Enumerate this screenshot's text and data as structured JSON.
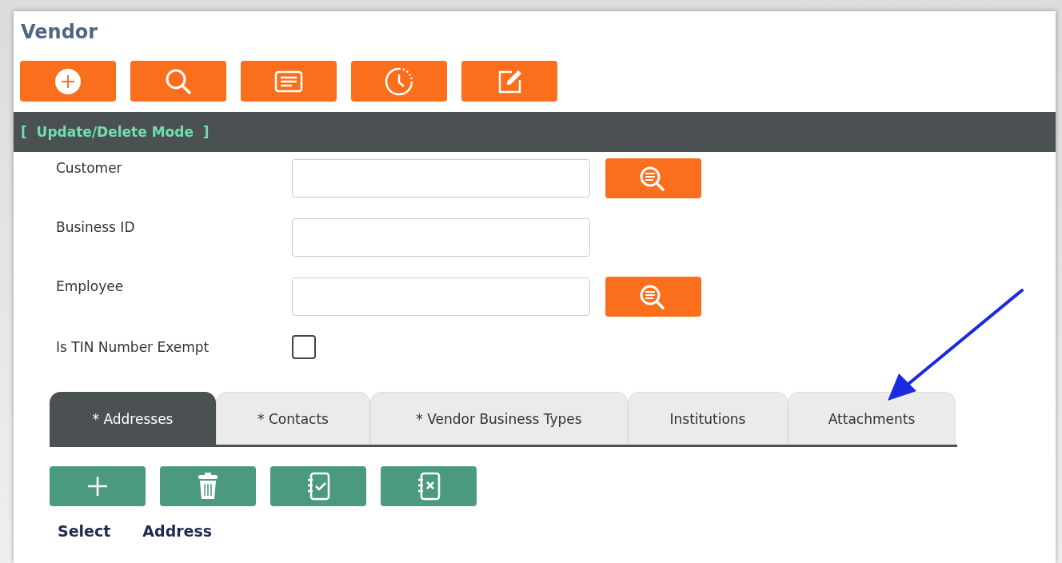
{
  "title": "Vendor",
  "mode": "[  Update/Delete Mode  ]",
  "fields": [
    {
      "label": "Customer",
      "kind": "lookup"
    },
    {
      "label": "Business ID",
      "kind": "text"
    },
    {
      "label": "Employee",
      "kind": "lookup"
    },
    {
      "label": "Is TIN Number Exempt",
      "kind": "checkbox",
      "checked": false
    }
  ],
  "tabs": [
    {
      "label": "* Addresses",
      "selected": true
    },
    {
      "label": "* Contacts",
      "selected": false
    },
    {
      "label": "* Vendor Business Types",
      "selected": false
    },
    {
      "label": "Institutions",
      "selected": false
    },
    {
      "label": "Attachments",
      "selected": false
    }
  ],
  "columns": [
    "Select",
    "Address"
  ]
}
